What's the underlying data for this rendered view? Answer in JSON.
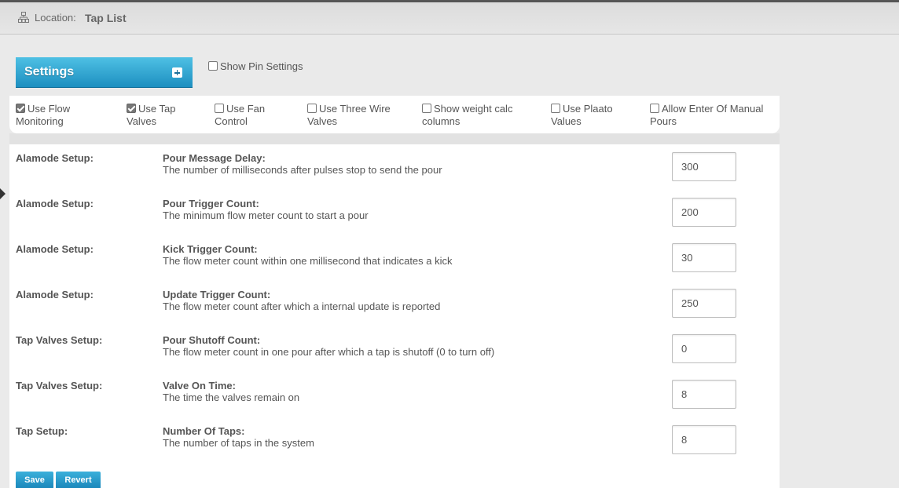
{
  "header": {
    "location_label": "Location:",
    "location_value": "Tap List",
    "icon": "sitemap-icon"
  },
  "settings_panel": {
    "title": "Settings",
    "expand_icon": "plus-icon",
    "accent_color": "#2aa0d0"
  },
  "show_pin_settings": {
    "label": "Show Pin Settings",
    "checked": false
  },
  "options": [
    {
      "line1": "Use Flow",
      "line2": "Monitoring",
      "checked": true
    },
    {
      "line1": "Use Tap",
      "line2": "Valves",
      "checked": true
    },
    {
      "line1": "Use Fan",
      "line2": "Control",
      "checked": false
    },
    {
      "line1": "Use Three Wire",
      "line2": "Valves",
      "checked": false
    },
    {
      "line1": "Show weight calc",
      "line2": "columns",
      "checked": false
    },
    {
      "line1": "Use Plaato",
      "line2": "Values",
      "checked": false
    },
    {
      "line1": "Allow Enter Of Manual",
      "line2": "Pours",
      "checked": false
    }
  ],
  "settings": [
    {
      "section": "Alamode Setup:",
      "name": "Pour Message Delay:",
      "description": "The number of milliseconds after pulses stop to send the pour",
      "value": "300"
    },
    {
      "section": "Alamode Setup:",
      "name": "Pour Trigger Count:",
      "description": "The minimum flow meter count to start a pour",
      "value": "200"
    },
    {
      "section": "Alamode Setup:",
      "name": "Kick Trigger Count:",
      "description": "The flow meter count within one millisecond that indicates a kick",
      "value": "30"
    },
    {
      "section": "Alamode Setup:",
      "name": "Update Trigger Count:",
      "description": "The flow meter count after which a internal update is reported",
      "value": "250"
    },
    {
      "section": "Tap Valves Setup:",
      "name": "Pour Shutoff Count:",
      "description": "The flow meter count in one pour after which a tap is shutoff (0 to turn off)",
      "value": "0"
    },
    {
      "section": "Tap Valves Setup:",
      "name": "Valve On Time:",
      "description": "The time the valves remain on",
      "value": "8"
    },
    {
      "section": "Tap Setup:",
      "name": "Number Of Taps:",
      "description": "The number of taps in the system",
      "value": "8"
    }
  ],
  "actions": {
    "save_label": "Save",
    "revert_label": "Revert"
  }
}
